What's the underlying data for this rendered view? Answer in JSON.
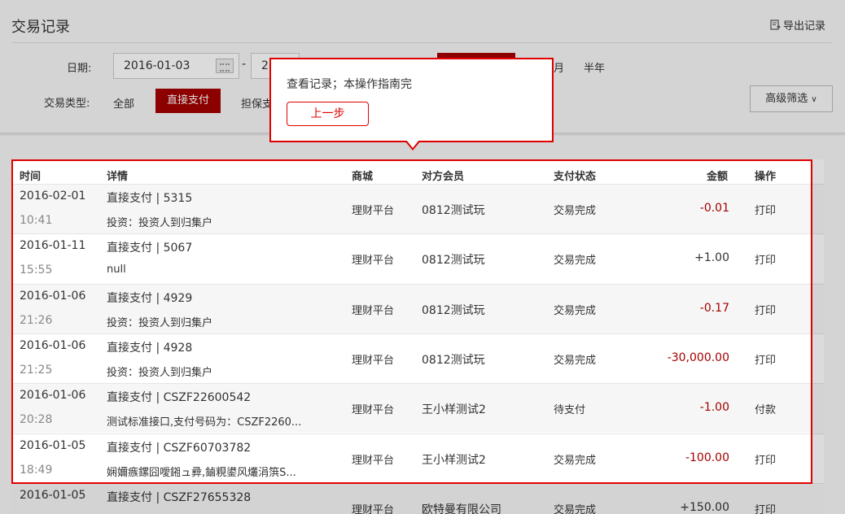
{
  "header": {
    "title": "交易记录",
    "export_label": "导出记录"
  },
  "filters": {
    "date_label": "日期:",
    "start_date": "2016-01-03",
    "end_date": "2",
    "dash": "-",
    "range_options": [
      "月",
      "半年"
    ],
    "type_label": "交易类型:",
    "type_options": [
      "全部",
      "直接支付",
      "担保支"
    ],
    "active_type": "直接支付",
    "advanced_label": "高级筛选"
  },
  "table": {
    "headers": {
      "time": "时间",
      "detail": "详情",
      "mall": "商城",
      "member": "对方会员",
      "status": "支付状态",
      "amount": "金额",
      "action": "操作"
    },
    "rows": [
      {
        "date": "2016-02-01",
        "time": "10:41",
        "title": "直接支付 | 5315",
        "desc": "投资：投资人到归集户",
        "mall": "理财平台",
        "member": "0812测试玩",
        "status": "交易完成",
        "amount": "-0.01",
        "action": "打印"
      },
      {
        "date": "2016-01-11",
        "time": "15:55",
        "title": "直接支付 | 5067",
        "desc": "null",
        "mall": "理财平台",
        "member": "0812测试玩",
        "status": "交易完成",
        "amount": "+1.00",
        "action": "打印"
      },
      {
        "date": "2016-01-06",
        "time": "21:26",
        "title": "直接支付 | 4929",
        "desc": "投资：投资人到归集户",
        "mall": "理财平台",
        "member": "0812测试玩",
        "status": "交易完成",
        "amount": "-0.17",
        "action": "打印"
      },
      {
        "date": "2016-01-06",
        "time": "21:25",
        "title": "直接支付 | 4928",
        "desc": "投资：投资人到归集户",
        "mall": "理财平台",
        "member": "0812测试玩",
        "status": "交易完成",
        "amount": "-30,000.00",
        "action": "打印"
      },
      {
        "date": "2016-01-06",
        "time": "20:28",
        "title": "直接支付 | CSZF22600542",
        "desc": "测试标准接口,支付号码为：CSZF2260...",
        "mall": "理财平台",
        "member": "王小样测试2",
        "status": "待支付",
        "amount": "-1.00",
        "action": "付款"
      },
      {
        "date": "2016-01-05",
        "time": "18:49",
        "title": "直接支付 | CSZF60703782",
        "desc": "娴嬭瘯鏍囧噯鎺ュ彛,鏀粯鍙风爜涓篊S...",
        "mall": "理财平台",
        "member": "王小样测试2",
        "status": "交易完成",
        "amount": "-100.00",
        "action": "打印"
      },
      {
        "date": "2016-01-05",
        "time": "",
        "title": "直接支付 | CSZF27655328",
        "desc": "",
        "mall": "理财平台",
        "member": "欧特曼有限公司",
        "status": "交易完成",
        "amount": "+150.00",
        "action": "打印"
      }
    ]
  },
  "guide": {
    "text": "查看记录；本操作指南完",
    "prev_label": "上一步"
  },
  "colors": {
    "brand_red": "#a40000",
    "highlight_red": "#e00000"
  }
}
